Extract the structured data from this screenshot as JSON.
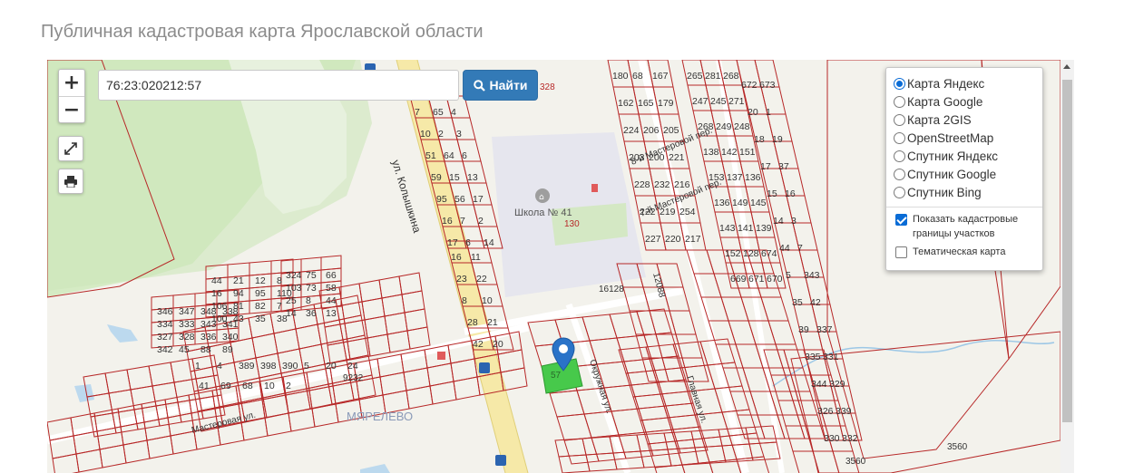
{
  "page": {
    "title": "Публичная кадастровая карта Ярославской области"
  },
  "controls": {
    "zoom_in": "+",
    "zoom_out": "−",
    "fullscreen_icon": "expand-icon",
    "print_icon": "printer-icon"
  },
  "search": {
    "value": "76:23:020212:57",
    "button_label": "Найти",
    "button_icon": "search-icon"
  },
  "layers": {
    "base_layers": [
      {
        "label": "Карта Яндекс",
        "selected": true
      },
      {
        "label": "Карта Google",
        "selected": false
      },
      {
        "label": "Карта 2GIS",
        "selected": false
      },
      {
        "label": "OpenStreetMap",
        "selected": false
      },
      {
        "label": "Спутник Яндекс",
        "selected": false
      },
      {
        "label": "Спутник Google",
        "selected": false
      },
      {
        "label": "Спутник Bing",
        "selected": false
      }
    ],
    "overlays": [
      {
        "label": "Показать кадастровые границы участков",
        "checked": true
      },
      {
        "label": "Тематическая карта",
        "checked": false
      }
    ]
  },
  "map": {
    "streets": [
      "ул. Колышкина",
      "8-й Мастеровой пер.",
      "7-й Мастеровой пер.",
      "Мастеровая ул.",
      "Окружная ул.",
      "Главная ул."
    ],
    "poi": [
      "Школа № 41"
    ],
    "district": "МЯРЕЛЕВО",
    "selected_parcel": "57",
    "labels": [
      "328",
      "130",
      "16128",
      "12088",
      "9232",
      "3560",
      "3560",
      "1"
    ],
    "parcel_numbers": [
      "180",
      "68",
      "167",
      "162",
      "165",
      "179",
      "224",
      "206",
      "205",
      "203",
      "200",
      "221",
      "228",
      "232",
      "216",
      "222",
      "219",
      "254",
      "227",
      "220",
      "217",
      "265",
      "281",
      "268",
      "247",
      "245",
      "271",
      "268",
      "249",
      "248",
      "138",
      "142",
      "151",
      "153",
      "137",
      "136",
      "136",
      "149",
      "145",
      "143",
      "141",
      "139",
      "152",
      "128",
      "674",
      "669",
      "671",
      "670",
      "672",
      "673",
      "20",
      "1",
      "18",
      "19",
      "17",
      "37",
      "15",
      "16",
      "14",
      "3",
      "44",
      "7",
      "5",
      "343",
      "35",
      "42",
      "39",
      "337",
      "335",
      "331",
      "344",
      "329",
      "326",
      "339",
      "330",
      "332",
      "346",
      "347",
      "348",
      "338",
      "334",
      "333",
      "343",
      "341",
      "327",
      "328",
      "336",
      "340",
      "342",
      "45",
      "88",
      "89",
      "44",
      "21",
      "12",
      "8",
      "16",
      "94",
      "95",
      "110",
      "106",
      "81",
      "82",
      "7",
      "100",
      "43",
      "35",
      "38",
      "324",
      "75",
      "66",
      "103",
      "73",
      "58",
      "25",
      "8",
      "44",
      "14",
      "36",
      "13",
      "7",
      "65",
      "4",
      "10",
      "2",
      "3",
      "51",
      "64",
      "6",
      "59",
      "15",
      "13",
      "95",
      "56",
      "17",
      "16",
      "7",
      "2",
      "17",
      "6",
      "14",
      "16",
      "11",
      "23",
      "22",
      "8",
      "10",
      "28",
      "21",
      "42",
      "20",
      "1",
      "4",
      "389",
      "398",
      "390",
      "5",
      "20",
      "24",
      "41",
      "69",
      "68",
      "10",
      "2"
    ]
  }
}
